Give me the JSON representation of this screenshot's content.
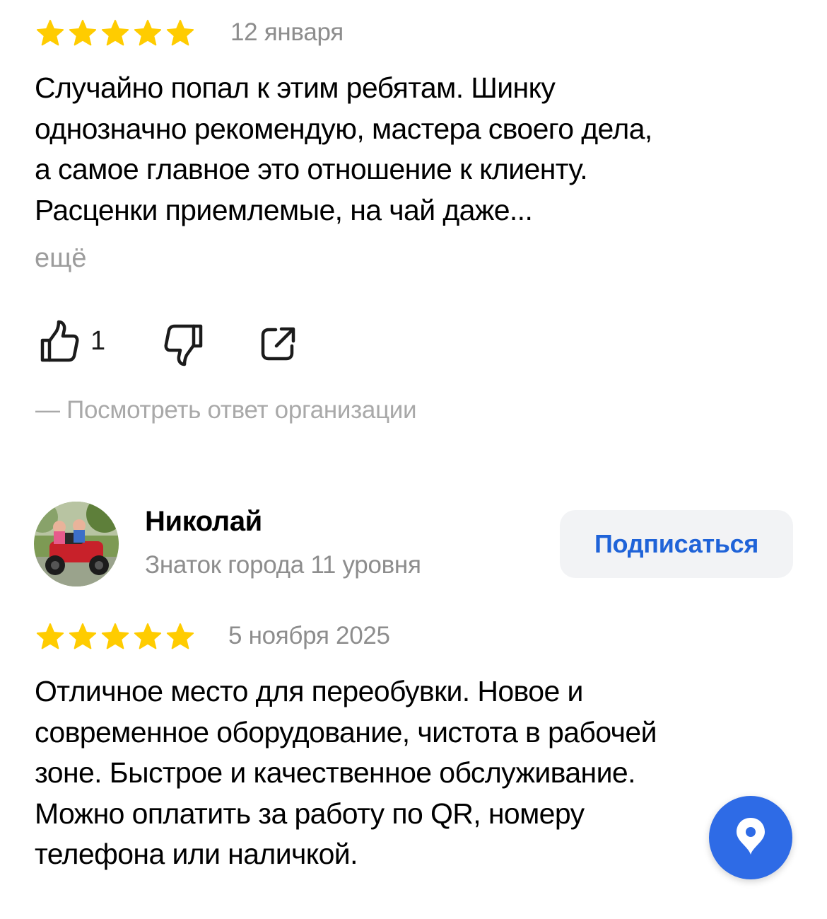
{
  "review1": {
    "rating": 5,
    "date": "12 января",
    "text": "Случайно попал к этим ребятам. Шинку\nоднозначно рекомендую, мастера своего дела,\nа самое главное это отношение к клиенту.\nРасценки приемлемые, на чай даже...",
    "more_label": "ещё",
    "likes": "1",
    "org_reply_label": "— Посмотреть ответ организации"
  },
  "review2": {
    "author": {
      "name": "Николай",
      "level": "Знаток города 11 уровня",
      "subscribe_label": "Подписаться"
    },
    "rating": 5,
    "date": "5 ноября 2025",
    "text": "Отличное место для переобувки. Новое и\nсовременное оборудование, чистота в рабочей\nзоне. Быстрое и качественное обслуживание.\nМожно оплатить за работу по QR, номеру\nтелефона или наличкой."
  },
  "icons": {
    "star": "star-icon",
    "like": "thumbs-up-icon",
    "dislike": "thumbs-down-icon",
    "share": "share-icon",
    "map_pin": "map-pin-icon"
  },
  "colors": {
    "star": "#ffcc00",
    "accent": "#1f63d8",
    "fab": "#2e6be6",
    "muted_text": "#8d8d8d"
  }
}
